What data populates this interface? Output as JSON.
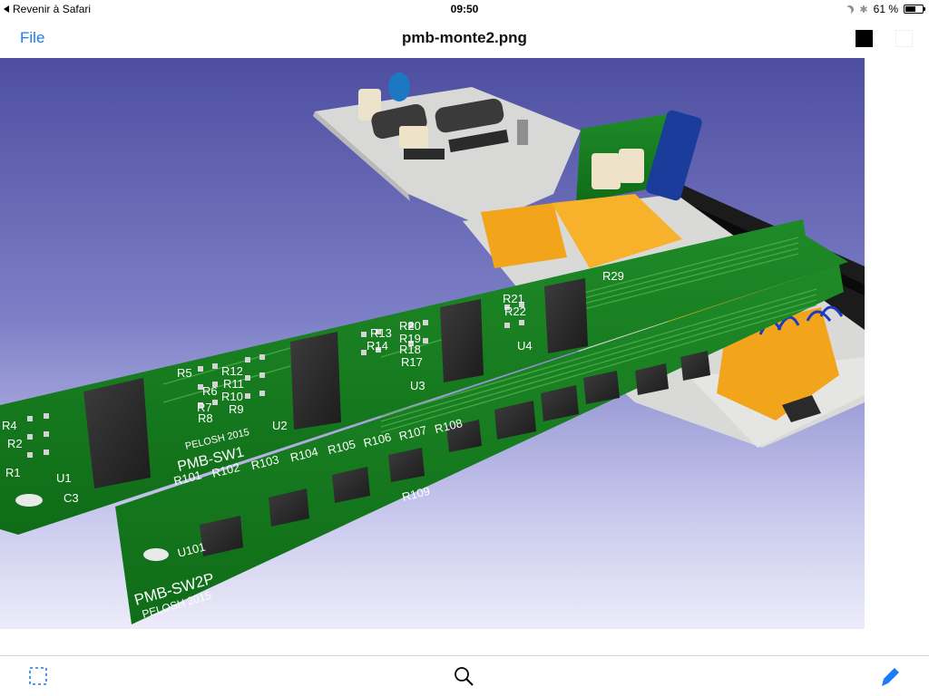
{
  "status_bar": {
    "back_label": "Revenir à Safari",
    "time": "09:50",
    "battery_label": "61 %",
    "battery_level": 0.61,
    "icons": [
      "back-arrow-icon",
      "moon-icon",
      "bluetooth-icon",
      "battery-icon"
    ]
  },
  "nav": {
    "file_label": "File",
    "title": "pmb-monte2.png",
    "accent_color": "#1a7cf5",
    "swatches": [
      "#000000",
      "#ffffff"
    ]
  },
  "image": {
    "board_labels": {
      "sw1_name": "PMB-SW1",
      "sw1_author": "PELOSH 2015",
      "sw2p_name": "PMB-SW2P",
      "sw2p_author": "PELOSH 2015"
    },
    "silkscreen_sw1": [
      "R4",
      "R2",
      "R1",
      "U1",
      "C3",
      "R5",
      "R6",
      "R7",
      "R8",
      "R12",
      "R11",
      "R10",
      "R9",
      "U2",
      "R13",
      "R14",
      "R20",
      "R19",
      "R18",
      "R17",
      "U3",
      "R21",
      "R22",
      "U4",
      "R29"
    ],
    "silkscreen_sw2p": [
      "R101",
      "R102",
      "R103",
      "R104",
      "R105",
      "R106",
      "R107",
      "R108",
      "R109",
      "U101"
    ]
  },
  "toolbar": {
    "icons": [
      "selection-icon",
      "search-icon",
      "markup-icon"
    ]
  }
}
